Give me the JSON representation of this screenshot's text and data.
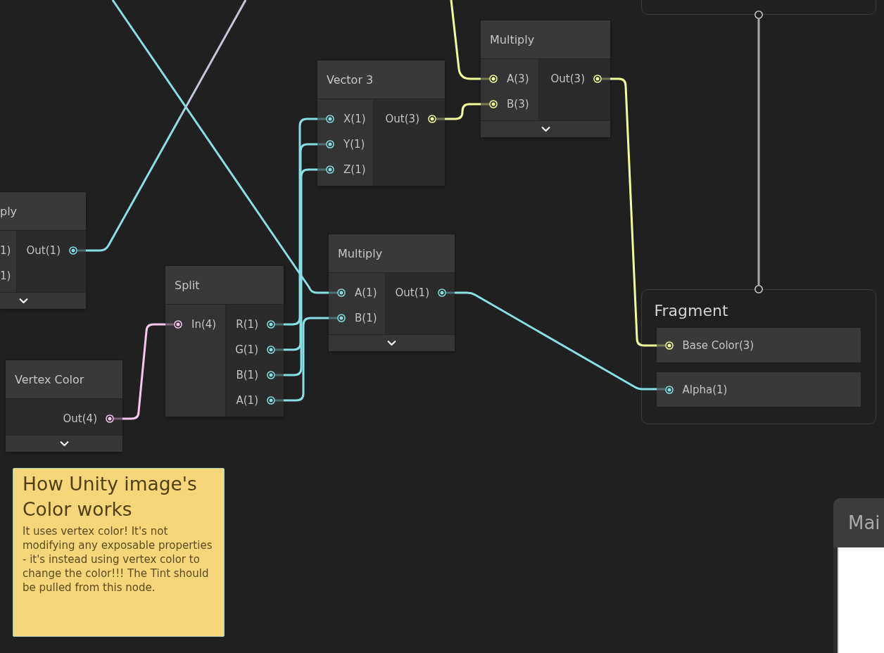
{
  "nodes": [
    {
      "title": "Multiply",
      "inputs": [
        {
          "label": "A(3)",
          "color": "#f4fb9b"
        },
        {
          "label": "B(3)",
          "color": "#f4fb9b"
        }
      ],
      "outputs": [
        {
          "label": "Out(3)",
          "color": "#f4fb9b"
        }
      ],
      "preview_toggle": true
    },
    {
      "title": "Vector 3",
      "inputs": [
        {
          "label": "X(1)",
          "color": "#86dfe2"
        },
        {
          "label": "Y(1)",
          "color": "#86dfe2"
        },
        {
          "label": "Z(1)",
          "color": "#86dfe2"
        }
      ],
      "outputs": [
        {
          "label": "Out(3)",
          "color": "#f4fb9b"
        }
      ],
      "preview_toggle": false
    },
    {
      "title": "ply",
      "inputs": [
        {
          "label": "1)"
        },
        {
          "label": "1)"
        }
      ],
      "outputs": [
        {
          "label": "Out(1)",
          "color": "#86dfe2"
        }
      ],
      "preview_toggle": true
    },
    {
      "title": "Multiply",
      "inputs": [
        {
          "label": "A(1)",
          "color": "#86dfe2"
        },
        {
          "label": "B(1)",
          "color": "#86dfe2"
        }
      ],
      "outputs": [
        {
          "label": "Out(1)",
          "color": "#86dfe2"
        }
      ],
      "preview_toggle": true
    },
    {
      "title": "Split",
      "inputs": [
        {
          "label": "In(4)",
          "color": "#f6c6ee"
        }
      ],
      "outputs": [
        {
          "label": "R(1)",
          "color": "#86dfe2"
        },
        {
          "label": "G(1)",
          "color": "#86dfe2"
        },
        {
          "label": "B(1)",
          "color": "#86dfe2"
        },
        {
          "label": "A(1)",
          "color": "#86dfe2"
        }
      ],
      "preview_toggle": false
    },
    {
      "title": "Vertex Color",
      "outputs": [
        {
          "label": "Out(4)",
          "color": "#f6c6ee"
        }
      ],
      "preview_toggle": true
    }
  ],
  "fragment": {
    "title": "Fragment",
    "slots": [
      {
        "label": "Base Color(3)",
        "color": "#f4fb9b"
      },
      {
        "label": "Alpha(1)",
        "color": "#86dfe2"
      }
    ]
  },
  "sticky_note": {
    "title": "How Unity image's Color works",
    "body": "It uses vertex color! It's not modifying any exposable properties - it's instead using vertex color to change the color!!! The Tint should be pulled from this node."
  },
  "main_preview": {
    "title": "Mai"
  }
}
